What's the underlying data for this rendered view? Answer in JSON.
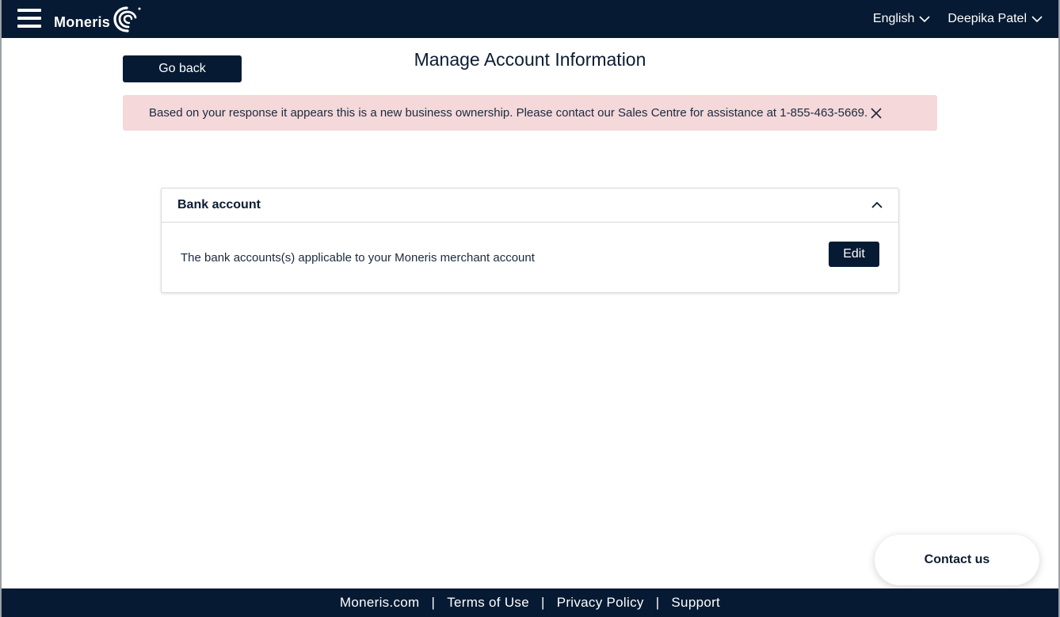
{
  "header": {
    "brand": "Moneris",
    "language": "English",
    "user": "Deepika Patel"
  },
  "page": {
    "title": "Manage Account Information",
    "go_back": "Go back"
  },
  "alert": {
    "message": "Based on your response it appears this is a new business ownership. Please contact our Sales Centre for assistance at 1-855-463-5669."
  },
  "card": {
    "title": "Bank account",
    "description": "The bank accounts(s) applicable to your Moneris merchant account",
    "edit_label": "Edit"
  },
  "contact": {
    "label": "Contact us"
  },
  "footer": {
    "links": [
      "Moneris.com",
      "Terms of Use",
      "Privacy Policy",
      "Support"
    ],
    "separator": "|"
  },
  "colors": {
    "navy": "#061a33",
    "alert_bg": "#f4d8da"
  },
  "icons": {
    "menu": "hamburger-menu-icon",
    "chevron": "chevron-down-icon",
    "collapse": "chevron-up-icon",
    "close": "close-icon"
  }
}
